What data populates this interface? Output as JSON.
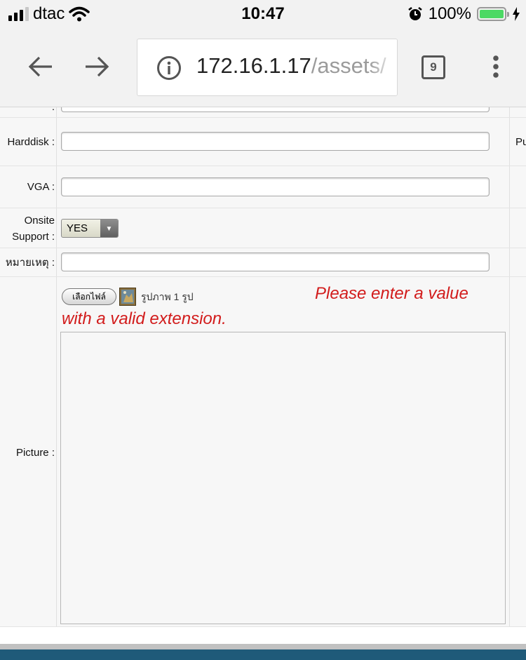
{
  "status_bar": {
    "carrier": "dtac",
    "time": "10:47",
    "battery_percent": "100%",
    "battery_level": 1.0,
    "icons": [
      "signal-icon",
      "wifi-icon",
      "alarm-icon",
      "battery-icon",
      "charging-icon"
    ]
  },
  "browser": {
    "url_host": "172.16.1.17",
    "url_path": "/assets/",
    "tab_count": "9",
    "icons": [
      "back-arrow-icon",
      "forward-arrow-icon",
      "info-icon",
      "tabs-icon",
      "menu-icon"
    ]
  },
  "form": {
    "partial_label": ":",
    "harddisk": {
      "label": "Harddisk :",
      "value": ""
    },
    "side_label": "Pu",
    "vga": {
      "label": "VGA :",
      "value": ""
    },
    "onsite_support": {
      "label_line1": "Onsite",
      "label_line2": "Support :",
      "selected": "YES"
    },
    "remark": {
      "label": "หมายเหตุ :",
      "value": ""
    },
    "picture": {
      "label": "Picture :",
      "file_button": "เลือกไฟล์",
      "file_status": "รูปภาพ 1 รูป",
      "error_line1": "Please enter a value",
      "error_line2": "with a valid extension."
    }
  },
  "colors": {
    "error": "#d21c1c",
    "battery_fill": "#4cd964",
    "footer": "#1f5a79"
  }
}
